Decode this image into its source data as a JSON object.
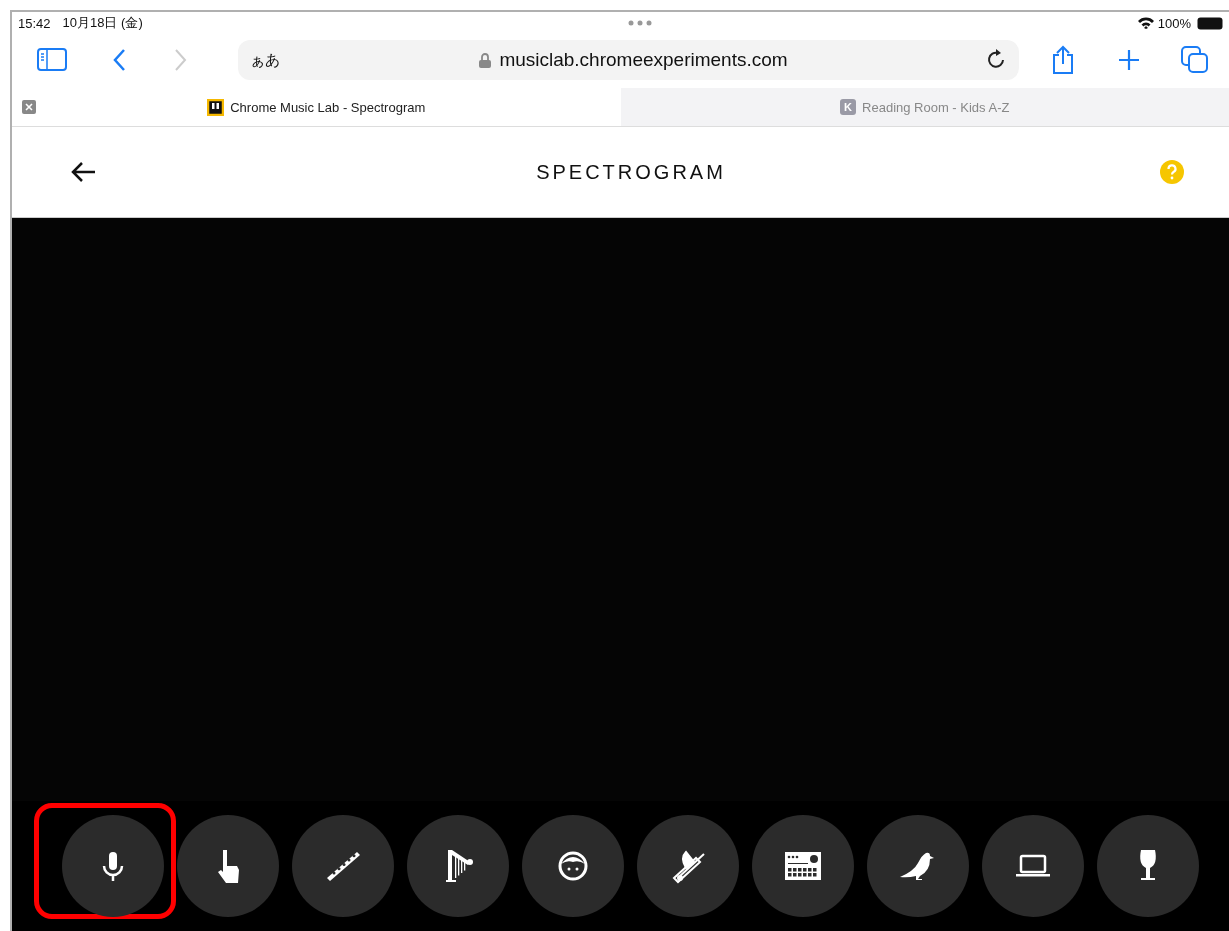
{
  "status_bar": {
    "time": "15:42",
    "date": "10月18日 (金)",
    "battery": "100%"
  },
  "address_bar": {
    "input_mode": "ぁあ",
    "url": "musiclab.chromeexperiments.com"
  },
  "tabs": [
    {
      "title": "Chrome Music Lab - Spectrogram",
      "selected": true
    },
    {
      "title": "Reading Room - Kids A-Z",
      "favicon": "K",
      "selected": false
    }
  ],
  "page": {
    "title": "SPECTROGRAM"
  },
  "instruments": [
    {
      "kind": "microphone",
      "highlighted": true
    },
    {
      "kind": "hand",
      "highlighted": false
    },
    {
      "kind": "flute",
      "highlighted": false
    },
    {
      "kind": "harp",
      "highlighted": false
    },
    {
      "kind": "voice",
      "highlighted": false
    },
    {
      "kind": "trombone",
      "highlighted": false
    },
    {
      "kind": "synth",
      "highlighted": false
    },
    {
      "kind": "bird",
      "highlighted": false
    },
    {
      "kind": "laptop",
      "highlighted": false
    },
    {
      "kind": "glass",
      "highlighted": false
    }
  ]
}
